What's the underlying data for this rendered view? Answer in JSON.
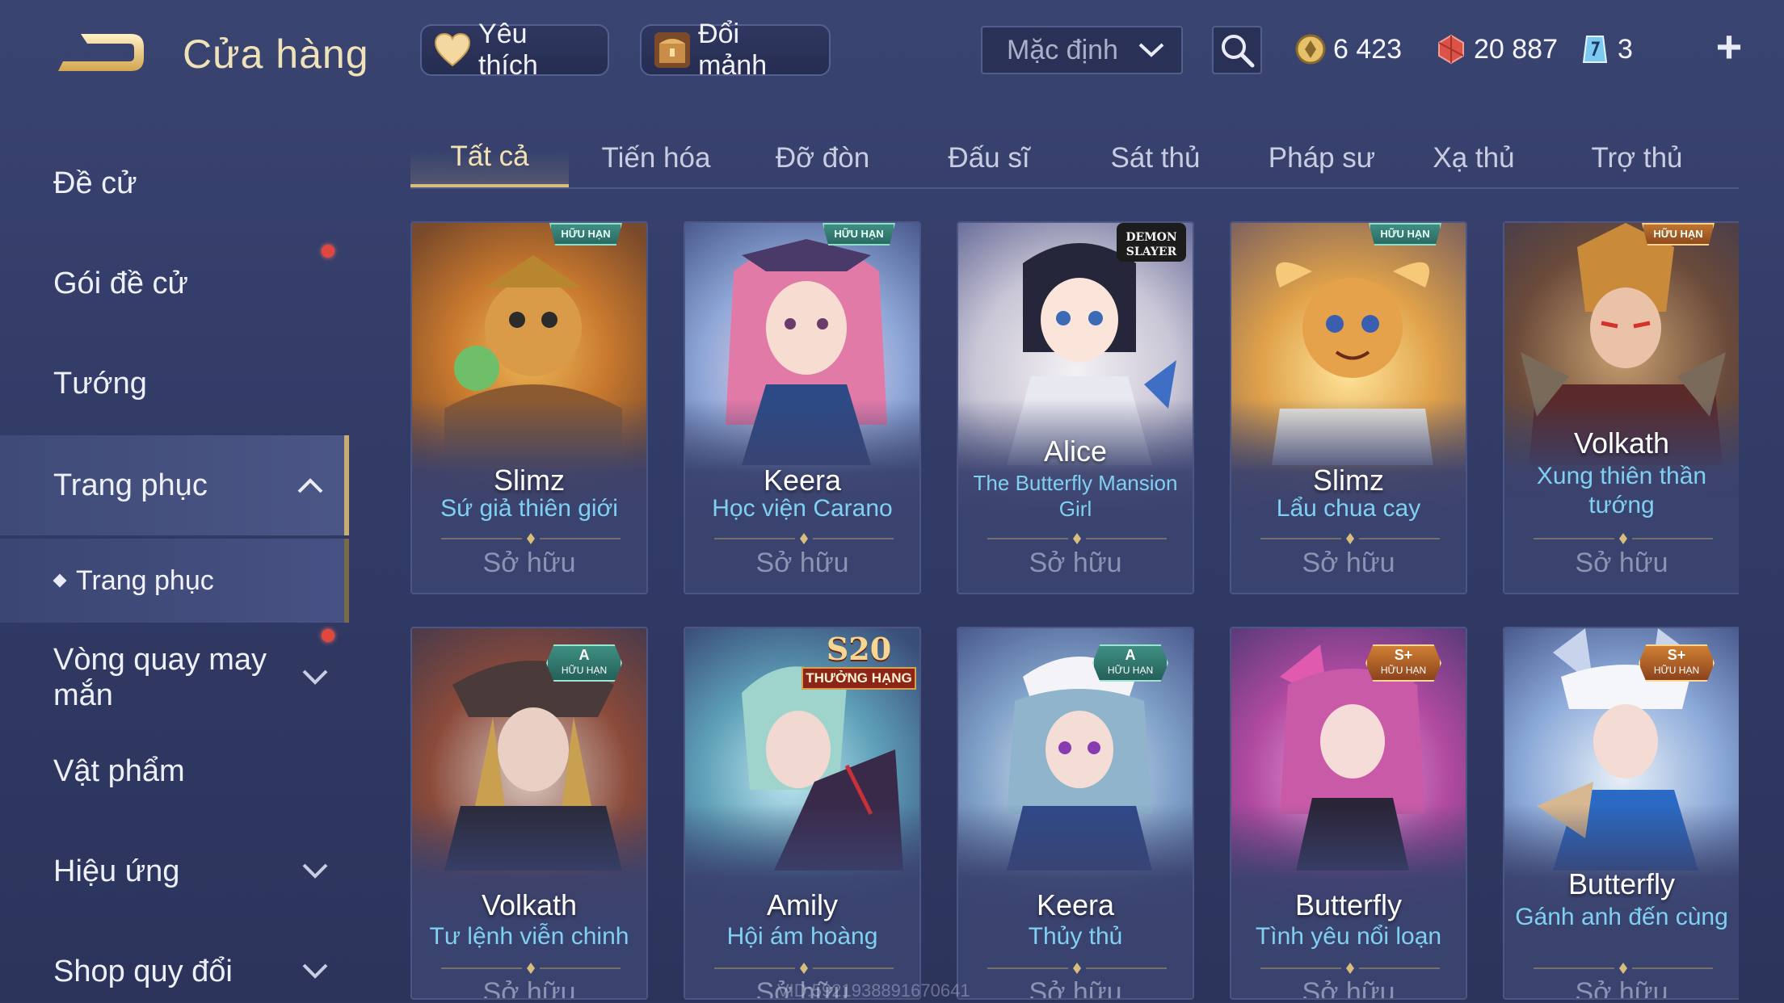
{
  "header": {
    "title": "Cửa hàng",
    "favorite_label": "Yêu thích",
    "shard_label": "Đổi mảnh",
    "sort_value": "Mặc định",
    "gold": "6 423",
    "gems": "20 887",
    "tickets": "3",
    "plus": "+"
  },
  "sidebar": {
    "items": [
      {
        "label": "Đề cử"
      },
      {
        "label": "Gói đề cử"
      },
      {
        "label": "Tướng"
      },
      {
        "label": "Trang phục"
      },
      {
        "label": "Vòng quay may mắn"
      },
      {
        "label": "Vật phẩm"
      },
      {
        "label": "Hiệu ứng"
      },
      {
        "label": "Shop quy đổi"
      }
    ],
    "sub_items": [
      {
        "label": "Trang phục"
      }
    ]
  },
  "tabs": [
    {
      "label": "Tất cả"
    },
    {
      "label": "Tiến hóa"
    },
    {
      "label": "Đỡ đòn"
    },
    {
      "label": "Đấu sĩ"
    },
    {
      "label": "Sát thủ"
    },
    {
      "label": "Pháp sư"
    },
    {
      "label": "Xạ thủ"
    },
    {
      "label": "Trợ thủ"
    }
  ],
  "cards": [
    {
      "hero": "Slimz",
      "skin": "Sứ giả thiên giới",
      "status": "Sở hữu",
      "badge": "HỮU HẠN"
    },
    {
      "hero": "Keera",
      "skin": "Học viện Carano",
      "status": "Sở hữu",
      "badge": "HỮU HẠN"
    },
    {
      "hero": "Alice",
      "skin": "The Butterfly Mansion Girl",
      "status": "Sở hữu",
      "badge": "SLAYER"
    },
    {
      "hero": "Slimz",
      "skin": "Lẩu chua cay",
      "status": "Sở hữu",
      "badge": "HỮU HẠN"
    },
    {
      "hero": "Volkath",
      "skin": "Xung thiên thần tướng",
      "status": "Sở hữu",
      "badge": "HỮU HẠN"
    },
    {
      "hero": "Volkath",
      "skin": "Tư lệnh viễn chinh",
      "status": "Sở hữu",
      "rank": "A",
      "badge": "HỮU HẠN"
    },
    {
      "hero": "Amily",
      "skin": "Hội ám hoàng",
      "status": "Sở hữu",
      "rank": "S20",
      "badge": "THƯỞNG HẠNG"
    },
    {
      "hero": "Keera",
      "skin": "Thủy thủ",
      "status": "Sở hữu",
      "rank": "A",
      "badge": "HỮU HẠN"
    },
    {
      "hero": "Butterfly",
      "skin": "Tình yêu nổi loạn",
      "status": "Sở hữu",
      "rank": "S+",
      "badge": "HỮU HẠN"
    },
    {
      "hero": "Butterfly",
      "skin": "Gánh anh đến cùng",
      "status": "Sở hữu",
      "rank": "S+",
      "badge": "HỮU HẠN"
    }
  ],
  "watermark": "VID:5921938891670641",
  "colors": {
    "accent_gold": "#d8bd7d",
    "skin_blue": "#7fd0f2",
    "background": "#323b66",
    "notification": "#e2473e"
  }
}
